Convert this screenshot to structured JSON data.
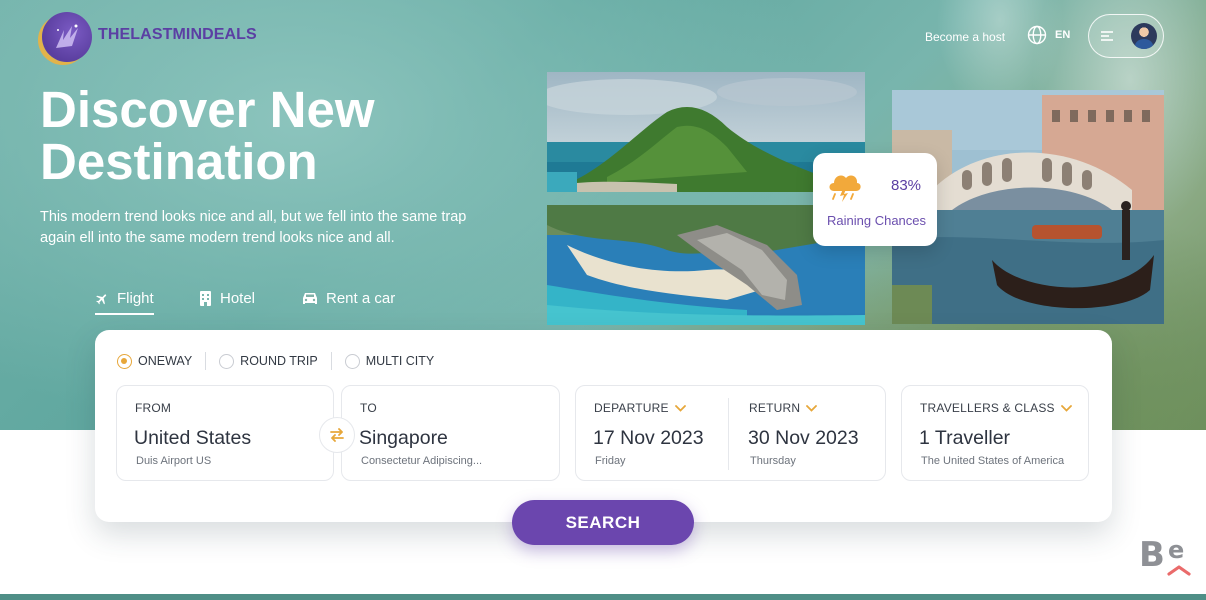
{
  "brand": {
    "name": "THELASTMINDEALS"
  },
  "header": {
    "become_host": "Become a host",
    "language": "EN",
    "icons": {
      "globe": "globe-icon",
      "menu": "hamburger-menu-icon"
    }
  },
  "hero": {
    "title_line1": "Discover New",
    "title_line2": "Destination",
    "subtitle_line1": "This modern trend looks nice and all, but we fell into the same trap",
    "subtitle_line2": "again ell into the same modern trend looks nice and all."
  },
  "tabs": [
    {
      "label": "Flight",
      "icon": "plane-icon",
      "active": true
    },
    {
      "label": "Hotel",
      "icon": "building-icon",
      "active": false
    },
    {
      "label": "Rent a car",
      "icon": "car-icon",
      "active": false
    }
  ],
  "weather": {
    "percent": "83%",
    "label": "Raining Chances",
    "icon": "rain-cloud-icon"
  },
  "search": {
    "trip_types": [
      {
        "label": "ONEWAY",
        "selected": true
      },
      {
        "label": "ROUND TRIP",
        "selected": false
      },
      {
        "label": "MULTI CITY",
        "selected": false
      }
    ],
    "from": {
      "label": "FROM",
      "value": "United States",
      "sub": "Duis Airport US"
    },
    "to": {
      "label": "TO",
      "value": "Singapore",
      "sub": "Consectetur Adipiscing..."
    },
    "departure": {
      "label": "DEPARTURE",
      "value": "17 Nov 2023",
      "sub": "Friday"
    },
    "return": {
      "label": "RETURN",
      "value": "30 Nov 2023",
      "sub": "Thursday"
    },
    "travellers": {
      "label": "TRAVELLERS & CLASS",
      "value": "1 Traveller",
      "sub": "The United States of America"
    },
    "button": "SEARCH"
  },
  "colors": {
    "accent": "#6b46ae",
    "highlight": "#e7a73a",
    "hero": "#6fb0a8"
  }
}
